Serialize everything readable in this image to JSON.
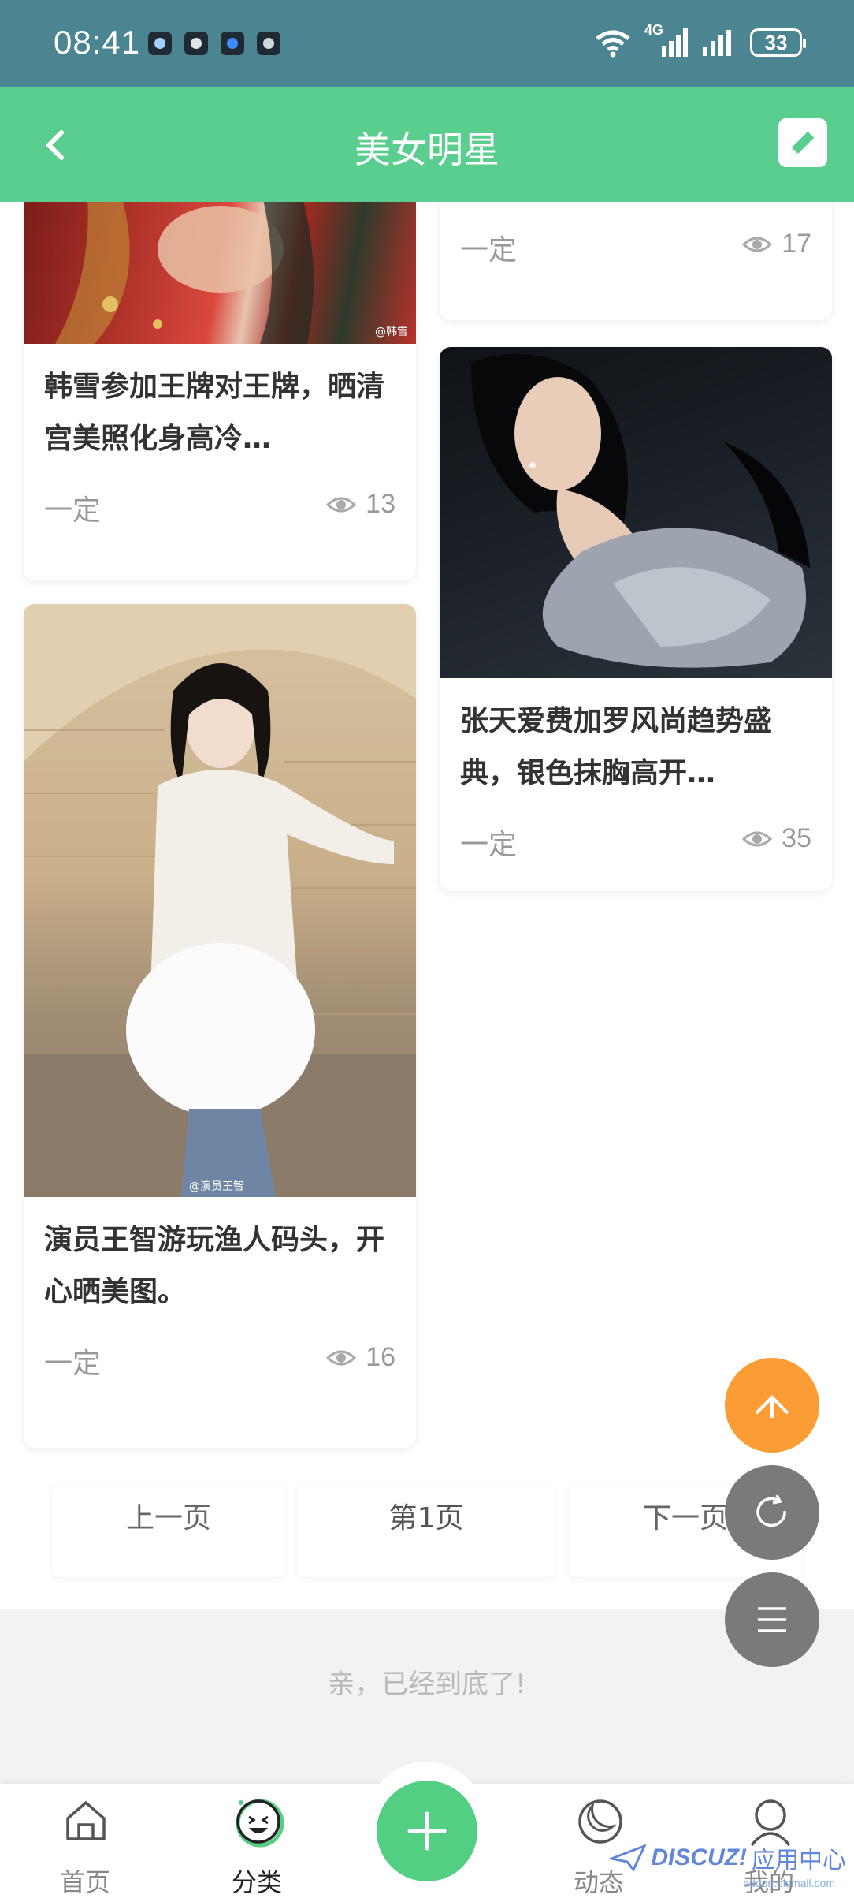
{
  "statusbar": {
    "time": "08:41",
    "network": "4G",
    "battery": "33"
  },
  "header": {
    "title": "美女明星"
  },
  "posts": [
    {
      "title": "",
      "author": "一定",
      "views": "17"
    },
    {
      "title": "韩雪参加王牌对王牌，晒清宫美照化身高冷…",
      "author": "一定",
      "views": "13",
      "image_watermark": "@韩雪"
    },
    {
      "title": "张天爱费加罗风尚趋势盛典，银色抹胸高开…",
      "author": "一定",
      "views": "35"
    },
    {
      "title": "演员王智游玩渔人码头，开心晒美图。",
      "author": "一定",
      "views": "16",
      "image_watermark": "@演员王智"
    }
  ],
  "pagination": {
    "prev": "上一页",
    "current": "第1页",
    "next": "下一页"
  },
  "end_message": "亲，已经到底了!",
  "tabbar": {
    "items": [
      {
        "label": "首页",
        "icon": "home-icon"
      },
      {
        "label": "分类",
        "icon": "smiley-icon"
      },
      {
        "label": "",
        "icon": "plus-icon"
      },
      {
        "label": "动态",
        "icon": "moon-icon"
      },
      {
        "label": "我的",
        "icon": "user-icon"
      }
    ]
  },
  "watermark": {
    "brand": "DISCUZ!",
    "text": "应用中心",
    "url": "addon.dismall.com"
  },
  "colors": {
    "statusbar": "#4b8592",
    "header": "#5ace8e",
    "accent_green": "#53cf83",
    "scroll_top": "#fb9c35",
    "fab_gray": "#7a7a7a"
  }
}
